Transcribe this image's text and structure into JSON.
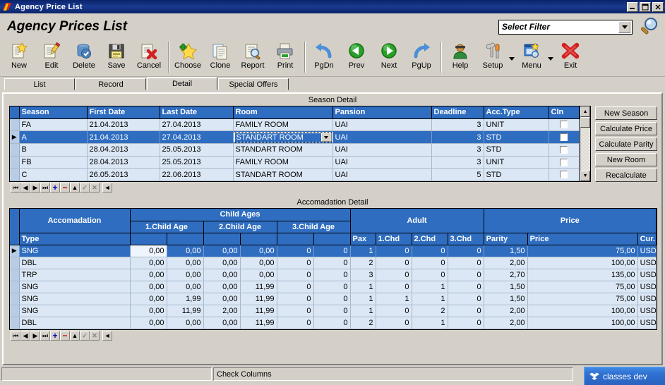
{
  "window": {
    "title": "Agency Price List",
    "minimize": "_",
    "maximize": "□",
    "close": "✕"
  },
  "header": {
    "page_title": "Agency Prices List",
    "filter_value": "Select Filter",
    "search_icon": "magnifier-icon"
  },
  "toolbar": {
    "groups": [
      [
        {
          "label": "New",
          "icon": "new-document-icon"
        },
        {
          "label": "Edit",
          "icon": "edit-pencil-icon"
        },
        {
          "label": "Delete",
          "icon": "delete-trash-icon"
        },
        {
          "label": "Save",
          "icon": "floppy-save-icon"
        },
        {
          "label": "Cancel",
          "icon": "cancel-red-x-icon"
        }
      ],
      [
        {
          "label": "Choose",
          "icon": "choose-star-icon"
        },
        {
          "label": "Clone",
          "icon": "clone-copy-icon"
        },
        {
          "label": "Report",
          "icon": "report-magnifier-icon"
        },
        {
          "label": "Print",
          "icon": "printer-icon"
        }
      ],
      [
        {
          "label": "PgDn",
          "icon": "arrow-back-blue-icon"
        },
        {
          "label": "Prev",
          "icon": "prev-green-left-icon"
        },
        {
          "label": "Next",
          "icon": "next-green-right-icon"
        },
        {
          "label": "PgUp",
          "icon": "arrow-forward-blue-icon"
        }
      ],
      [
        {
          "label": "Help",
          "icon": "help-person-icon"
        },
        {
          "label": "Setup",
          "icon": "setup-wrench-icon",
          "dropdown": true
        },
        {
          "label": "Menu",
          "icon": "menu-window-icon",
          "dropdown": true
        },
        {
          "label": "Exit",
          "icon": "exit-red-x-icon"
        }
      ]
    ]
  },
  "tabs": [
    {
      "label": "List",
      "active": false
    },
    {
      "label": "Record",
      "active": false
    },
    {
      "label": "Detail",
      "active": true
    },
    {
      "label": "Special Offers",
      "active": false
    }
  ],
  "season_detail": {
    "caption": "Season Detail",
    "columns": [
      "Season",
      "First Date",
      "Last Date",
      "Room",
      "Pansion",
      "Deadline",
      "Acc.Type",
      "CIn"
    ],
    "rows": [
      {
        "season": "FA",
        "first_date": "21.04.2013",
        "last_date": "27.04.2013",
        "room": "FAMILY ROOM",
        "pansion": "UAI",
        "deadline": "3",
        "acc_type": "UNIT",
        "cin": false,
        "selected": false,
        "editing": false
      },
      {
        "season": "A",
        "first_date": "21.04.2013",
        "last_date": "27.04.2013",
        "room": "STANDART ROOM",
        "pansion": "UAI",
        "deadline": "3",
        "acc_type": "STD",
        "cin": false,
        "selected": true,
        "editing": true
      },
      {
        "season": "B",
        "first_date": "28.04.2013",
        "last_date": "25.05.2013",
        "room": "STANDART ROOM",
        "pansion": "UAI",
        "deadline": "3",
        "acc_type": "STD",
        "cin": false,
        "selected": false,
        "editing": false
      },
      {
        "season": "FB",
        "first_date": "28.04.2013",
        "last_date": "25.05.2013",
        "room": "FAMILY ROOM",
        "pansion": "UAI",
        "deadline": "3",
        "acc_type": "UNIT",
        "cin": false,
        "selected": false,
        "editing": false
      },
      {
        "season": "C",
        "first_date": "26.05.2013",
        "last_date": "22.06.2013",
        "room": "STANDART ROOM",
        "pansion": "UAI",
        "deadline": "5",
        "acc_type": "STD",
        "cin": false,
        "selected": false,
        "editing": false
      }
    ],
    "side_buttons": [
      {
        "label": "New Season"
      },
      {
        "label": "Calculate Price"
      },
      {
        "label": "Calculate Parity"
      },
      {
        "label": "New Room"
      },
      {
        "label": "Recalculate"
      }
    ],
    "nav": [
      "⏮",
      "◀",
      "▶",
      "⏭",
      "+",
      "−",
      "▲",
      "✓",
      "✕"
    ]
  },
  "accomodation_detail": {
    "caption": "Accomadation Detail",
    "group_headers": [
      {
        "label": "Accomadation",
        "span": 1
      },
      {
        "label": "Child Ages",
        "span": 6
      },
      {
        "label": "Adult",
        "span": 4
      },
      {
        "label": "Price",
        "span": 3
      }
    ],
    "sub_headers": [
      "1.Child Age",
      "2.Child Age",
      "3.Child Age"
    ],
    "columns": [
      "Type",
      "",
      "",
      "",
      "",
      "",
      "",
      "Pax",
      "1.Chd",
      "2.Chd",
      "3.Chd",
      "Parity",
      "Price",
      "Cur."
    ],
    "rows": [
      {
        "type": "SNG",
        "c1a": "0,00",
        "c1b": "0,00",
        "c2a": "0,00",
        "c2b": "0,00",
        "c3a": "0",
        "c3b": "0",
        "pax": "1",
        "chd1": "0",
        "chd2": "0",
        "chd3": "0",
        "parity": "1,50",
        "price": "75,00",
        "cur": "USD",
        "selected": true
      },
      {
        "type": "DBL",
        "c1a": "0,00",
        "c1b": "0,00",
        "c2a": "0,00",
        "c2b": "0,00",
        "c3a": "0",
        "c3b": "0",
        "pax": "2",
        "chd1": "0",
        "chd2": "0",
        "chd3": "0",
        "parity": "2,00",
        "price": "100,00",
        "cur": "USD",
        "selected": false
      },
      {
        "type": "TRP",
        "c1a": "0,00",
        "c1b": "0,00",
        "c2a": "0,00",
        "c2b": "0,00",
        "c3a": "0",
        "c3b": "0",
        "pax": "3",
        "chd1": "0",
        "chd2": "0",
        "chd3": "0",
        "parity": "2,70",
        "price": "135,00",
        "cur": "USD",
        "selected": false
      },
      {
        "type": "SNG",
        "c1a": "0,00",
        "c1b": "0,00",
        "c2a": "0,00",
        "c2b": "11,99",
        "c3a": "0",
        "c3b": "0",
        "pax": "1",
        "chd1": "0",
        "chd2": "1",
        "chd3": "0",
        "parity": "1,50",
        "price": "75,00",
        "cur": "USD",
        "selected": false
      },
      {
        "type": "SNG",
        "c1a": "0,00",
        "c1b": "1,99",
        "c2a": "0,00",
        "c2b": "11,99",
        "c3a": "0",
        "c3b": "0",
        "pax": "1",
        "chd1": "1",
        "chd2": "1",
        "chd3": "0",
        "parity": "1,50",
        "price": "75,00",
        "cur": "USD",
        "selected": false
      },
      {
        "type": "SNG",
        "c1a": "0,00",
        "c1b": "11,99",
        "c2a": "2,00",
        "c2b": "11,99",
        "c3a": "0",
        "c3b": "0",
        "pax": "1",
        "chd1": "0",
        "chd2": "2",
        "chd3": "0",
        "parity": "2,00",
        "price": "100,00",
        "cur": "USD",
        "selected": false
      },
      {
        "type": "DBL",
        "c1a": "0,00",
        "c1b": "0,00",
        "c2a": "0,00",
        "c2b": "11,99",
        "c3a": "0",
        "c3b": "0",
        "pax": "2",
        "chd1": "0",
        "chd2": "1",
        "chd3": "0",
        "parity": "2,00",
        "price": "100,00",
        "cur": "USD",
        "selected": false
      }
    ],
    "nav": [
      "⏮",
      "◀",
      "▶",
      "⏭",
      "+",
      "−",
      "▲",
      "✓",
      "✕"
    ]
  },
  "statusbar": {
    "left_panel": "",
    "right_panel": "Check Columns"
  },
  "taskbar": {
    "item_label": "classes dev",
    "item_icon": "dropbox-icon"
  },
  "colors": {
    "title_bar": "#0a246a",
    "grid_header": "#2f6dc0",
    "grid_row": "#dbe7f5",
    "selection": "#2f6dc0",
    "chrome": "#d4d0c8"
  }
}
